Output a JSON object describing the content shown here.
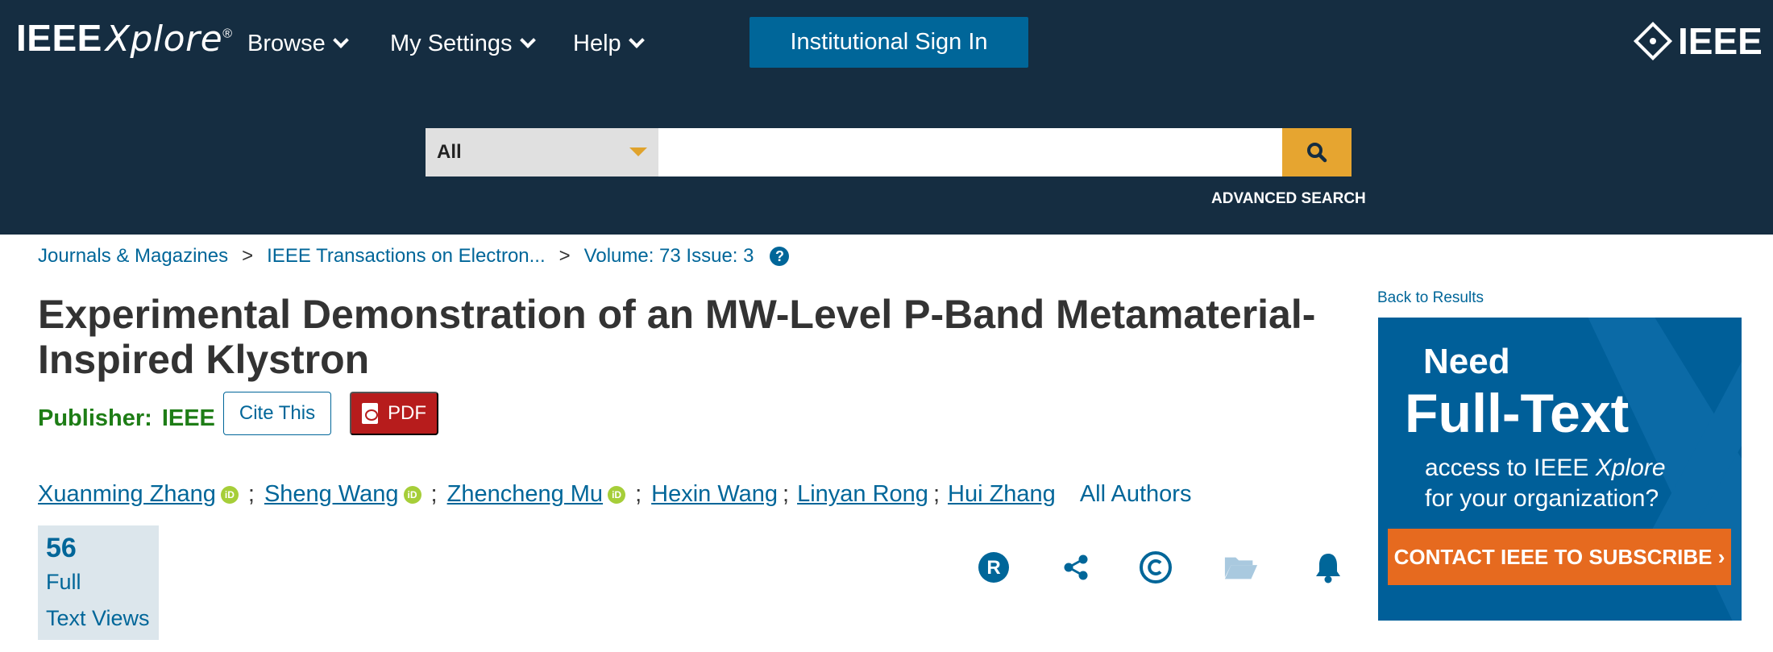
{
  "header": {
    "logo_main": "IEEE",
    "logo_xplore": "Xplore",
    "logo_reg": "®",
    "nav": [
      "Browse",
      "My Settings",
      "Help"
    ],
    "signin_label": "Institutional Sign In",
    "ieee_logo": "IEEE"
  },
  "search": {
    "scope": "All",
    "query": "",
    "placeholder": "",
    "advanced_label": "ADVANCED SEARCH"
  },
  "breadcrumb": {
    "items": [
      "Journals & Magazines",
      "IEEE Transactions on Electron...",
      "Volume: 73 Issue: 3"
    ],
    "separator": ">",
    "help_glyph": "?"
  },
  "article": {
    "title": "Experimental Demonstration of an MW-Level P-Band Metamaterial-Inspired Klystron",
    "publisher_label": "Publisher:",
    "publisher_value": "IEEE",
    "cite_label": "Cite This",
    "pdf_label": "PDF",
    "authors": [
      "Xuanming Zhang",
      "Sheng Wang",
      "Zhencheng Mu",
      "Hexin Wang",
      "Linyan Rong",
      "Hui Zhang"
    ],
    "author_sep": ";",
    "orcid_glyph": "iD",
    "all_authors_label": "All Authors"
  },
  "metrics": {
    "count": "56",
    "label_line1": "Full",
    "label_line2": "Text Views"
  },
  "actions": {
    "icons": [
      "rights-icon",
      "share-icon",
      "copyright-icon",
      "folder-icon",
      "alert-bell-icon"
    ],
    "color": "#006699"
  },
  "sidebar": {
    "back_label": "Back to Results",
    "ad": {
      "need": "Need",
      "full_text": "Full-Text",
      "access_line1_pre": "access to IEEE",
      "access_line1_italic": "Xplore",
      "access_line2": "for your organization?",
      "cta": "CONTACT IEEE TO SUBSCRIBE ›"
    }
  },
  "colors": {
    "header_bg": "#152d41",
    "link": "#006699",
    "publisher": "#1e7d16",
    "pdf": "#b71c1c",
    "search_btn": "#e6a530",
    "cta": "#e66a1f"
  }
}
